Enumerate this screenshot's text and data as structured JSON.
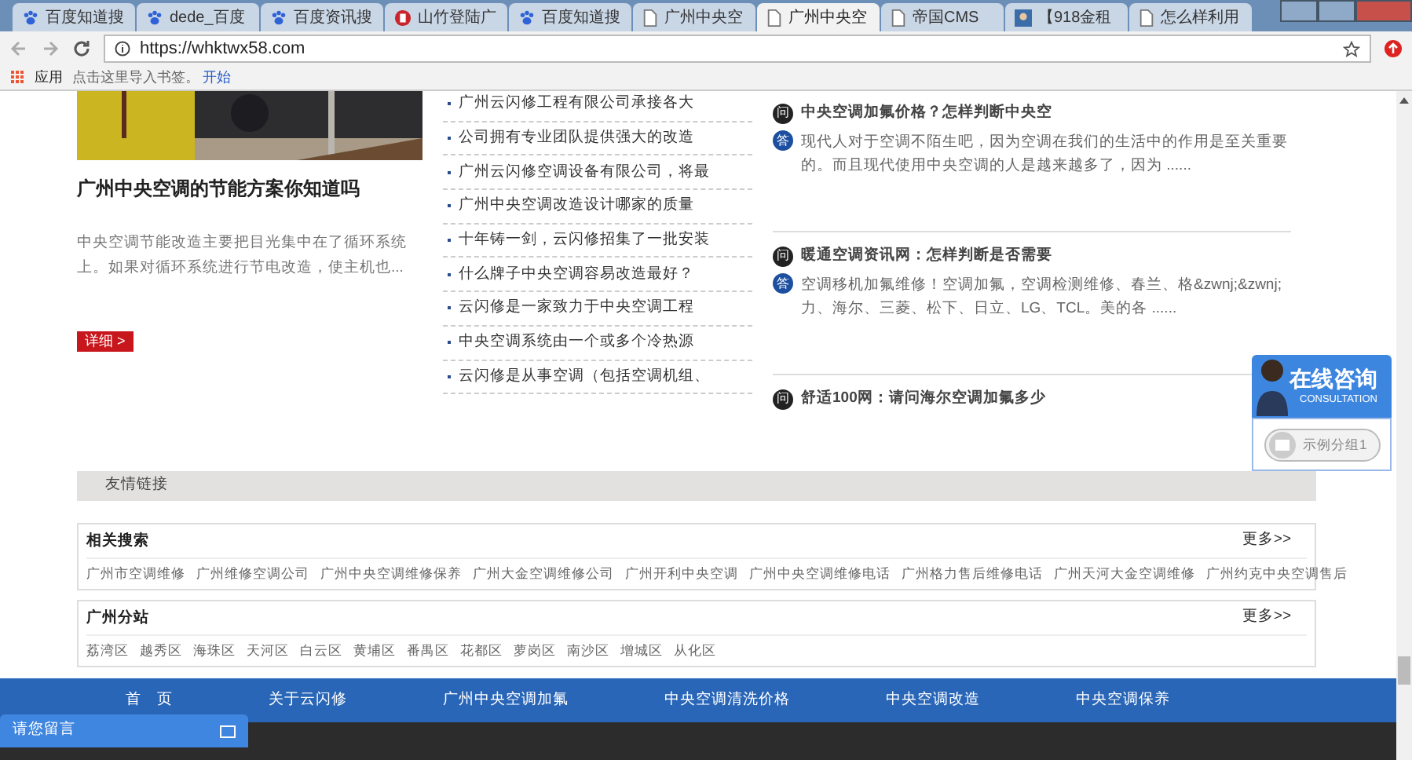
{
  "browser": {
    "tabs": [
      {
        "label": "百度知道搜",
        "kind": "paw",
        "selected": false
      },
      {
        "label": "dede_百度",
        "kind": "paw",
        "selected": false
      },
      {
        "label": "百度资讯搜",
        "kind": "paw",
        "selected": false
      },
      {
        "label": "山竹登陆广",
        "kind": "logo",
        "selected": false
      },
      {
        "label": "百度知道搜",
        "kind": "paw",
        "selected": false
      },
      {
        "label": "广州中央空",
        "kind": "page",
        "selected": false
      },
      {
        "label": "广州中央空",
        "kind": "page",
        "selected": true
      },
      {
        "label": "帝国CMS",
        "kind": "page",
        "selected": false
      },
      {
        "label": "【918金租",
        "kind": "avatar",
        "selected": false
      },
      {
        "label": "怎么样利用",
        "kind": "page",
        "selected": false
      }
    ],
    "url": "https://whktwx58.com",
    "bookmarks": {
      "apps": "应用",
      "hint": "点击这里导入书签。",
      "link": "开始"
    }
  },
  "feature": {
    "title": "广州中央空调的节能方案你知道吗",
    "summary": "中央空调节能改造主要把目光集中在了循环系统上。如果对循环系统进行节电改造，使主机也...",
    "button": "详细 >"
  },
  "news": [
    "广州云闪修工程有限公司承接各大",
    "公司拥有专业团队提供强大的改造",
    "广州云闪修空调设备有限公司，将最",
    "广州中央空调改造设计哪家的质量",
    "十年铸一剑，云闪修招集了一批安装",
    "什么牌子中央空调容易改造最好？",
    "云闪修是一家致力于中央空调工程",
    "中央空调系统由一个或多个冷热源",
    "云闪修是从事空调（包括空调机组、"
  ],
  "qa": [
    {
      "q_mark": "问",
      "question": "中央空调加氟价格？怎样判断中央空",
      "a_mark": "答",
      "answer": "现代人对于空调不陌生吧，因为空调在我们的生活中的作用是至关重要的。而且现代使用中央空调的人是越来越多了，因为 ......"
    },
    {
      "q_mark": "问",
      "question": "暖通空调资讯网：怎样判断是否需要",
      "a_mark": "答",
      "answer": "空调移机加氟维修！空调加氟，空调检测维修、春兰、格&zwnj;&zwnj;力、海尔、三菱、松下、日立、LG、TCL。美的各 ......"
    },
    {
      "q_mark": "问",
      "question": "舒适100网：请问海尔空调加氟多少"
    }
  ],
  "friend_links": {
    "title": "友情链接"
  },
  "link_boxes": [
    {
      "title": "相关搜索",
      "more": "更多>>",
      "links": [
        "广州市空调维修",
        "广州维修空调公司",
        "广州中央空调维修保养",
        "广州大金空调维修公司",
        "广州开利中央空调",
        "广州中央空调维修电话",
        "广州格力售后维修电话",
        "广州天河大金空调维修",
        "广州约克中央空调售后"
      ]
    },
    {
      "title": "广州分站",
      "more": "更多>>",
      "links": [
        "荔湾区",
        "越秀区",
        "海珠区",
        "天河区",
        "白云区",
        "黄埔区",
        "番禺区",
        "花都区",
        "萝岗区",
        "南沙区",
        "增城区",
        "从化区"
      ]
    }
  ],
  "footer_nav": [
    "首　页",
    "关于云闪修",
    "广州中央空调加氟",
    "中央空调清洗价格",
    "中央空调改造",
    "中央空调保养"
  ],
  "consult": {
    "title": "在线咨询",
    "subtitle": "CONSULTATION",
    "group": "示例分组1"
  },
  "message_box": {
    "title": "请您留言"
  }
}
